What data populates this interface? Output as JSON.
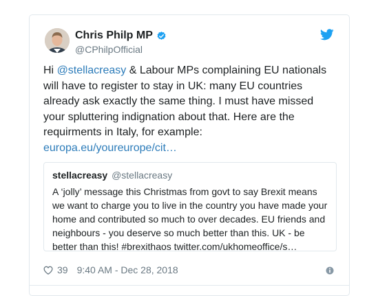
{
  "author": {
    "name": "Chris Philp MP",
    "handle": "@CPhilpOfficial"
  },
  "icons": {
    "verified": "verified-badge-icon",
    "platform": "twitter-bird-icon",
    "like": "heart-icon",
    "info": "info-icon"
  },
  "colors": {
    "link": "#2b7bb9",
    "verified": "#1da1f2",
    "brand": "#1da1f2",
    "muted": "#697882"
  },
  "tweet": {
    "lines": [
      {
        "prefix": "Hi ",
        "mention": "@stellacreasy",
        "rest": " & Labour MPs complaining EU nationals"
      },
      {
        "text": "will have to register to stay in UK: many EU countries"
      },
      {
        "text": "already ask exactly the same thing. I must have missed"
      },
      {
        "text": "your spluttering indignation about that. Here are the"
      },
      {
        "text": "requirments in Italy, for example:"
      }
    ],
    "link": "europa.eu/youreurope/cit…"
  },
  "quoted": {
    "name": "stellacreasy",
    "handle": "@stellacreasy",
    "lines": [
      "A ‘jolly’ message this Christmas from govt to say Brexit means",
      "we want to charge you to live in the country you have made your",
      "home and contributed so much to over decades. EU friends and",
      "neighbours - you deserve so much better than this. UK - be",
      "better than this!  #brexithaos twitter.com/ukhomeoffice/s…"
    ]
  },
  "footer": {
    "likes": "39",
    "timestamp": "9:40 AM - Dec 28, 2018"
  }
}
